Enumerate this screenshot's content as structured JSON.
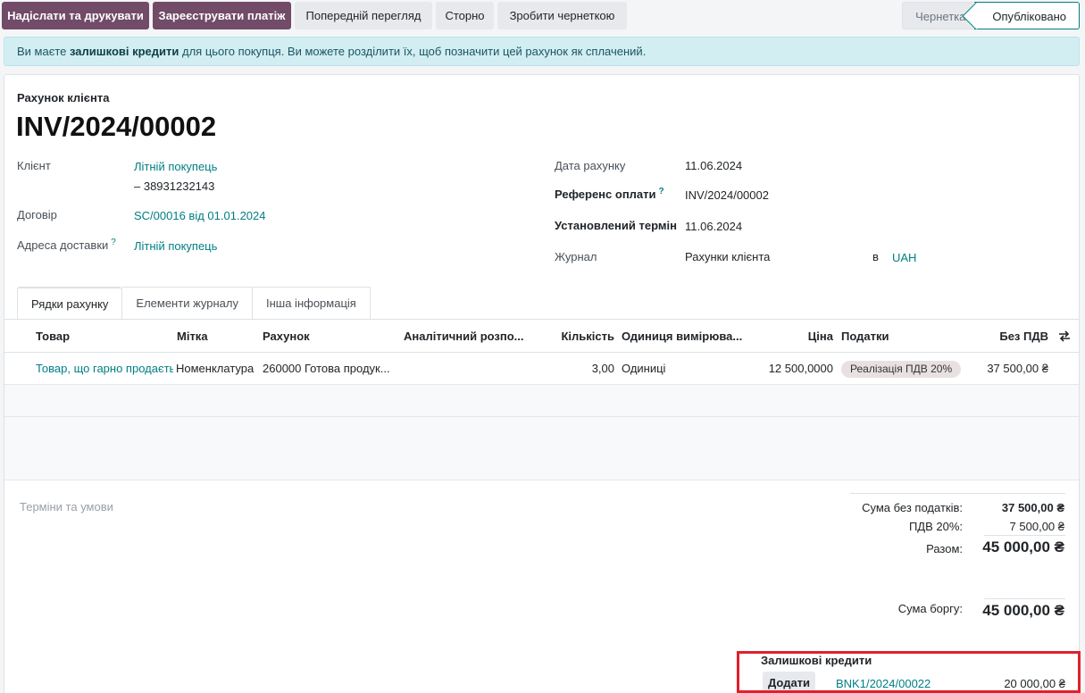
{
  "toolbar": {
    "send_print": "Надіслати та друкувати",
    "register_payment": "Зареєструвати платіж",
    "preview": "Попередній перегляд",
    "reverse": "Сторно",
    "reset_draft": "Зробити чернеткою"
  },
  "status": {
    "draft": "Чернетка",
    "posted": "Опубліковано"
  },
  "alert": {
    "part1": "Ви маєте ",
    "bold": "залишкові кредити",
    "part2": " для цього покупця. Ви можете розділити їх, щоб позначити цей рахунок як сплачений."
  },
  "header": {
    "doc_type": "Рахунок клієнта",
    "number": "INV/2024/00002"
  },
  "fields": {
    "client_label": "Клієнт",
    "client_value": "Літній покупець",
    "client_phone": "– 38931232143",
    "contract_label": "Договір",
    "contract_value": "SC/00016 від 01.01.2024",
    "delivery_label": "Адреса доставки",
    "delivery_help": "?",
    "delivery_value": "Літній покупець",
    "invoice_date_label": "Дата рахунку",
    "invoice_date_value": "11.06.2024",
    "payment_ref_label": "Референс оплати",
    "payment_ref_help": "?",
    "payment_ref_value": "INV/2024/00002",
    "due_label": "Установлений термін",
    "due_value": "11.06.2024",
    "journal_label": "Журнал",
    "journal_value": "Рахунки клієнта",
    "currency_in": "в",
    "currency_value": "UAH"
  },
  "tabs": [
    "Рядки рахунку",
    "Елементи журналу",
    "Інша інформація"
  ],
  "table": {
    "headers": {
      "product": "Товар",
      "label": "Мітка",
      "account": "Рахунок",
      "analytic": "Аналітичний розпо...",
      "qty": "Кількість",
      "uom": "Одиниця вимірюва...",
      "price": "Ціна",
      "taxes": "Податки",
      "subtotal": "Без ПДВ"
    },
    "rows": [
      {
        "product": "Товар, що гарно продаєтьс",
        "label": "Номенклатура",
        "account": "260000 Готова продук...",
        "analytic": "",
        "qty": "3,00",
        "uom": "Одиниці",
        "price": "12 500,0000",
        "tax": "Реалізація ПДВ 20%",
        "subtotal": "37 500,00 ₴"
      }
    ]
  },
  "terms_placeholder": "Терміни та умови",
  "totals": {
    "untaxed_label": "Сума без податків:",
    "untaxed_value": "37 500,00 ₴",
    "vat_label": "ПДВ 20%:",
    "vat_value": "7 500,00 ₴",
    "total_label": "Разом:",
    "total_value": "45 000,00 ₴",
    "due_label": "Сума боргу:",
    "due_value": "45 000,00 ₴"
  },
  "outstanding": {
    "title": "Залишкові кредити",
    "add_label": "Додати",
    "ref": "BNK1/2024/00022",
    "amount": "20 000,00 ₴"
  },
  "colors": {
    "primary": "#714b67",
    "link": "#017e84",
    "alert_bg": "#d2eef2",
    "highlight": "#e0202c"
  }
}
